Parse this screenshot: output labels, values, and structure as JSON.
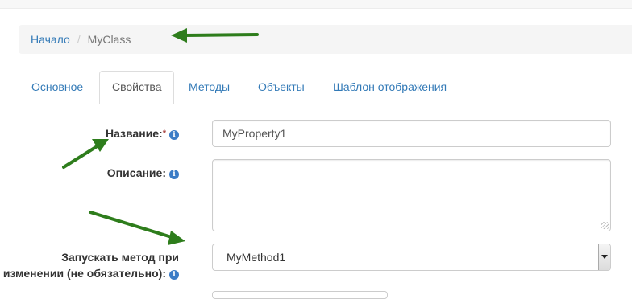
{
  "breadcrumb": {
    "home": "Начало",
    "separator": "/",
    "current": "MyClass"
  },
  "tabs": [
    {
      "label": "Основное",
      "active": false
    },
    {
      "label": "Свойства",
      "active": true
    },
    {
      "label": "Методы",
      "active": false
    },
    {
      "label": "Объекты",
      "active": false
    },
    {
      "label": "Шаблон отображения",
      "active": false
    }
  ],
  "form": {
    "name": {
      "label": "Название:",
      "required_mark": "*",
      "value": "MyProperty1"
    },
    "description": {
      "label": "Описание:",
      "value": ""
    },
    "on_change_method": {
      "label_line1": "Запускать метод при",
      "label_line2": "изменении (не обязательно):",
      "value": "MyMethod1"
    }
  },
  "icons": {
    "info": "info-icon",
    "dropdown": "chevron-down-icon"
  },
  "colors": {
    "link": "#337ab7",
    "annotation_arrow": "#2e7d1c",
    "info_icon": "#3b7cc6",
    "required": "#a94442"
  }
}
